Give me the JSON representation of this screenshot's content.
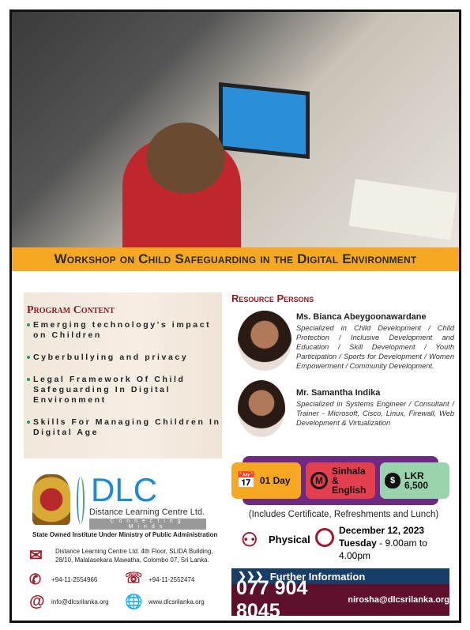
{
  "banner": {
    "title": "Workshop on Child Safeguarding in the Digital Environment"
  },
  "program": {
    "heading": "Program Content",
    "items": [
      "Emerging technology's impact on Children",
      "Cyberbullying and privacy",
      "Legal Framework Of Child Safeguarding In Digital Environment",
      "Skills For Managing Children In Digital Age"
    ]
  },
  "resource": {
    "heading": "Resource Persons",
    "persons": [
      {
        "name": "Ms. Bianca Abeygoonawardane",
        "desc": "Specialized in Child Development / Child Protection / Inclusive Development and Education / Skill Development / Youth Participation / Sports for Development / Women Empowerment / Community Development."
      },
      {
        "name": "Mr. Samantha Indika",
        "desc": "Specialized in Systems Engineer / Consultant / Trainer - Microsoft, Cisco, Linux, Firewall, Web Development & Virtualization"
      }
    ]
  },
  "badges": {
    "duration": "01 Day",
    "language": "Sinhala & English",
    "language_icon": "M",
    "fee": "LKR 6,500"
  },
  "includes": "(Includes Certificate, Refreshments and Lunch)",
  "mode": "Physical",
  "date": {
    "date": "December 12, 2023",
    "day": "Tuesday",
    "time": "- 9.00am to 4.00pm"
  },
  "further": {
    "label": "Further Information",
    "phone": "077 904 8045",
    "email": "nirosha@dlcsrilanka.org"
  },
  "org": {
    "logo": "DLC",
    "name": "Distance Learning Centre Ltd.",
    "tagline": "Connecting Minds",
    "state": "State Owned Institute Under Ministry of Public Administration",
    "address": "Distance Learning Centre Ltd. 4th Floor, SLIDA Building, 28/10, Malalasekara Mawatha, Colombo 07, Sri Lanka.",
    "phone": "+94-11-2554966",
    "fax": "+94-11-2552474",
    "email": "info@dlcsrilanka.org",
    "web": "www.dlcsrilanka.org"
  },
  "colors": {
    "orange": "#f7a823",
    "maroon": "#5e0f2b",
    "navy": "#173e68",
    "purple": "#6e2a83",
    "red": "#a0192a"
  }
}
